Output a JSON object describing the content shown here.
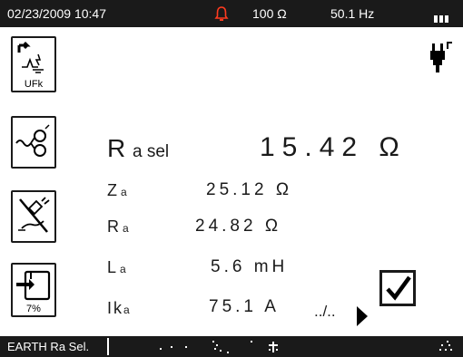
{
  "status_bar": {
    "datetime": "02/23/2009 10:47",
    "resistance": "100 Ω",
    "frequency": "50.1 Hz",
    "bell_icon": "alarm-bell-icon",
    "battery_icon": "battery-icon",
    "accent_color": "#ff3b1f"
  },
  "function_keys": {
    "ufk_label": "UFk",
    "save_label": "7%"
  },
  "readings": {
    "main_label": "R",
    "main_sub": "a sel",
    "main_value": "15.42 Ω",
    "za_label": "Z",
    "za_sub": "a",
    "za_value": "25.12 Ω",
    "ra_label": "R",
    "ra_sub": "a",
    "ra_value": "24.82 Ω",
    "la_label": "L",
    "la_sub": "a",
    "la_value": "5.6 mH",
    "ika_label": "Ik",
    "ika_sub": "a",
    "ika_value": "75.1 A"
  },
  "page_indicator": "../..",
  "checkbox": {
    "checked": true,
    "mark": "✓"
  },
  "bottom_bar": {
    "title": "EARTH Ra Sel."
  }
}
